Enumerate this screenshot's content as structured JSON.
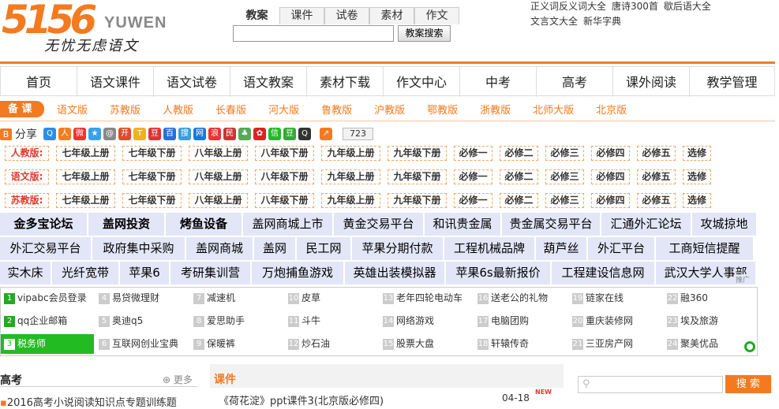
{
  "logo": {
    "number": "5156",
    "english": "YUWEN",
    "slogan": "无忧无虑语文"
  },
  "search": {
    "tabs": [
      "教案",
      "课件",
      "试卷",
      "素材",
      "作文"
    ],
    "active_tab": 0,
    "query": "",
    "button": "教案搜索"
  },
  "top_links": [
    "正义词反义词大全",
    "唐诗300首",
    "歇后语大全",
    "文言文大全",
    "新华字典"
  ],
  "nav": [
    "首页",
    "语文课件",
    "语文试卷",
    "语文教案",
    "素材下载",
    "作文中心",
    "中考",
    "高考",
    "课外阅读",
    "教学管理"
  ],
  "subnav": {
    "badge": "备 课",
    "items": [
      "语文版",
      "苏教版",
      "人教版",
      "长春版",
      "河大版",
      "鲁教版",
      "沪教版",
      "鄂教版",
      "浙教版",
      "北师大版",
      "北京版"
    ]
  },
  "share": {
    "label": "分享",
    "count": "723"
  },
  "grade_rows": [
    {
      "label": "人教版:",
      "items": [
        "七年级上册",
        "七年级下册",
        "八年级上册",
        "八年级下册",
        "九年级上册",
        "九年级下册",
        "必修一",
        "必修二",
        "必修三",
        "必修四",
        "必修五",
        "选修"
      ]
    },
    {
      "label": "语文版:",
      "items": [
        "七年级上册",
        "七年级下册",
        "八年级上册",
        "八年级下册",
        "九年级上册",
        "九年级下册",
        "必修一",
        "必修二",
        "必修三",
        "必修四",
        "必修五",
        "选修"
      ]
    },
    {
      "label": "苏教版:",
      "items": [
        "七年级上册",
        "七年级下册",
        "八年级上册",
        "八年级下册",
        "九年级上册",
        "九年级下册",
        "必修一",
        "必修二",
        "必修三",
        "必修四",
        "必修五",
        "选修"
      ]
    }
  ],
  "ad_rows": [
    [
      "金多宝论坛",
      "盖网投资",
      "烤鱼设备",
      "盖网商城上市",
      "黄金交易平台",
      "和讯贵金属",
      "贵金属交易平台",
      "汇通外汇论坛",
      "攻城掠地"
    ],
    [
      "外汇交易平台",
      "政府集中采购",
      "盖网商城",
      "盖网",
      "民工网",
      "苹果分期付款",
      "工程机械品牌",
      "葫芦丝",
      "外汇平台",
      "工商短信提醒"
    ],
    [
      "实木床",
      "光纤宽带",
      "苹果6",
      "考研集训营",
      "万炮捕鱼游戏",
      "英雄出装模拟器",
      "苹果6s最新报价",
      "工程建设信息网",
      "武汉大学人事部"
    ]
  ],
  "ad_tag": "推广",
  "grid": [
    [
      "1",
      "vipabc会员登录"
    ],
    [
      "2",
      "qq企业邮箱"
    ],
    [
      "3",
      "税务师"
    ],
    [
      "4",
      "易贷微理财"
    ],
    [
      "5",
      "奥迪q5"
    ],
    [
      "6",
      "互联网创业宝典"
    ],
    [
      "7",
      "减速机"
    ],
    [
      "8",
      "爱思助手"
    ],
    [
      "9",
      "保暖裤"
    ],
    [
      "10",
      "皮草"
    ],
    [
      "11",
      "斗牛"
    ],
    [
      "12",
      "炒石油"
    ],
    [
      "13",
      "老年四轮电动车"
    ],
    [
      "14",
      "网络游戏"
    ],
    [
      "15",
      "股票大盘"
    ],
    [
      "16",
      "送老公的礼物"
    ],
    [
      "17",
      "电脑团购"
    ],
    [
      "18",
      "轩辕传奇"
    ],
    [
      "19",
      "链家在线"
    ],
    [
      "20",
      "重庆装修网"
    ],
    [
      "21",
      "三亚房产网"
    ],
    [
      "22",
      "融360"
    ],
    [
      "23",
      "埃及旅游"
    ],
    [
      "24",
      "聚美优品"
    ]
  ],
  "gaokao": {
    "title": "高考",
    "more": "更多",
    "item": "2016高考小说阅读知识点专题训练题"
  },
  "kejian": {
    "title": "课件",
    "item": "《荷花淀》ppt课件3(北京版必修四)",
    "date": "04-18",
    "new": "NEW"
  },
  "bottom_search": {
    "button": "搜 索"
  }
}
